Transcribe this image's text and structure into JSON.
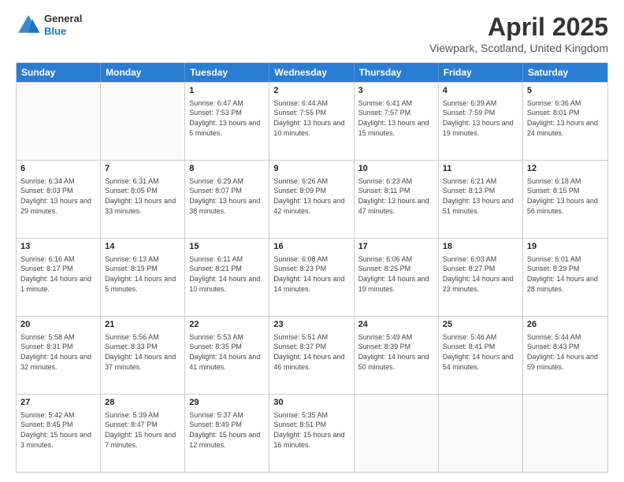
{
  "logo": {
    "general": "General",
    "blue": "Blue"
  },
  "title": {
    "month": "April 2025",
    "location": "Viewpark, Scotland, United Kingdom"
  },
  "header_days": [
    "Sunday",
    "Monday",
    "Tuesday",
    "Wednesday",
    "Thursday",
    "Friday",
    "Saturday"
  ],
  "weeks": [
    [
      {
        "date": "",
        "info": ""
      },
      {
        "date": "",
        "info": ""
      },
      {
        "date": "1",
        "info": "Sunrise: 6:47 AM\nSunset: 7:53 PM\nDaylight: 13 hours and 5 minutes."
      },
      {
        "date": "2",
        "info": "Sunrise: 6:44 AM\nSunset: 7:55 PM\nDaylight: 13 hours and 10 minutes."
      },
      {
        "date": "3",
        "info": "Sunrise: 6:41 AM\nSunset: 7:57 PM\nDaylight: 13 hours and 15 minutes."
      },
      {
        "date": "4",
        "info": "Sunrise: 6:39 AM\nSunset: 7:59 PM\nDaylight: 13 hours and 19 minutes."
      },
      {
        "date": "5",
        "info": "Sunrise: 6:36 AM\nSunset: 8:01 PM\nDaylight: 13 hours and 24 minutes."
      }
    ],
    [
      {
        "date": "6",
        "info": "Sunrise: 6:34 AM\nSunset: 8:03 PM\nDaylight: 13 hours and 29 minutes."
      },
      {
        "date": "7",
        "info": "Sunrise: 6:31 AM\nSunset: 8:05 PM\nDaylight: 13 hours and 33 minutes."
      },
      {
        "date": "8",
        "info": "Sunrise: 6:29 AM\nSunset: 8:07 PM\nDaylight: 13 hours and 38 minutes."
      },
      {
        "date": "9",
        "info": "Sunrise: 6:26 AM\nSunset: 8:09 PM\nDaylight: 13 hours and 42 minutes."
      },
      {
        "date": "10",
        "info": "Sunrise: 6:23 AM\nSunset: 8:11 PM\nDaylight: 13 hours and 47 minutes."
      },
      {
        "date": "11",
        "info": "Sunrise: 6:21 AM\nSunset: 8:13 PM\nDaylight: 13 hours and 51 minutes."
      },
      {
        "date": "12",
        "info": "Sunrise: 6:18 AM\nSunset: 8:15 PM\nDaylight: 13 hours and 56 minutes."
      }
    ],
    [
      {
        "date": "13",
        "info": "Sunrise: 6:16 AM\nSunset: 8:17 PM\nDaylight: 14 hours and 1 minute."
      },
      {
        "date": "14",
        "info": "Sunrise: 6:13 AM\nSunset: 8:19 PM\nDaylight: 14 hours and 5 minutes."
      },
      {
        "date": "15",
        "info": "Sunrise: 6:11 AM\nSunset: 8:21 PM\nDaylight: 14 hours and 10 minutes."
      },
      {
        "date": "16",
        "info": "Sunrise: 6:08 AM\nSunset: 8:23 PM\nDaylight: 14 hours and 14 minutes."
      },
      {
        "date": "17",
        "info": "Sunrise: 6:06 AM\nSunset: 8:25 PM\nDaylight: 14 hours and 19 minutes."
      },
      {
        "date": "18",
        "info": "Sunrise: 6:03 AM\nSunset: 8:27 PM\nDaylight: 14 hours and 23 minutes."
      },
      {
        "date": "19",
        "info": "Sunrise: 6:01 AM\nSunset: 8:29 PM\nDaylight: 14 hours and 28 minutes."
      }
    ],
    [
      {
        "date": "20",
        "info": "Sunrise: 5:58 AM\nSunset: 8:31 PM\nDaylight: 14 hours and 32 minutes."
      },
      {
        "date": "21",
        "info": "Sunrise: 5:56 AM\nSunset: 8:33 PM\nDaylight: 14 hours and 37 minutes."
      },
      {
        "date": "22",
        "info": "Sunrise: 5:53 AM\nSunset: 8:35 PM\nDaylight: 14 hours and 41 minutes."
      },
      {
        "date": "23",
        "info": "Sunrise: 5:51 AM\nSunset: 8:37 PM\nDaylight: 14 hours and 46 minutes."
      },
      {
        "date": "24",
        "info": "Sunrise: 5:49 AM\nSunset: 8:39 PM\nDaylight: 14 hours and 50 minutes."
      },
      {
        "date": "25",
        "info": "Sunrise: 5:46 AM\nSunset: 8:41 PM\nDaylight: 14 hours and 54 minutes."
      },
      {
        "date": "26",
        "info": "Sunrise: 5:44 AM\nSunset: 8:43 PM\nDaylight: 14 hours and 59 minutes."
      }
    ],
    [
      {
        "date": "27",
        "info": "Sunrise: 5:42 AM\nSunset: 8:45 PM\nDaylight: 15 hours and 3 minutes."
      },
      {
        "date": "28",
        "info": "Sunrise: 5:39 AM\nSunset: 8:47 PM\nDaylight: 15 hours and 7 minutes."
      },
      {
        "date": "29",
        "info": "Sunrise: 5:37 AM\nSunset: 8:49 PM\nDaylight: 15 hours and 12 minutes."
      },
      {
        "date": "30",
        "info": "Sunrise: 5:35 AM\nSunset: 8:51 PM\nDaylight: 15 hours and 16 minutes."
      },
      {
        "date": "",
        "info": ""
      },
      {
        "date": "",
        "info": ""
      },
      {
        "date": "",
        "info": ""
      }
    ]
  ]
}
